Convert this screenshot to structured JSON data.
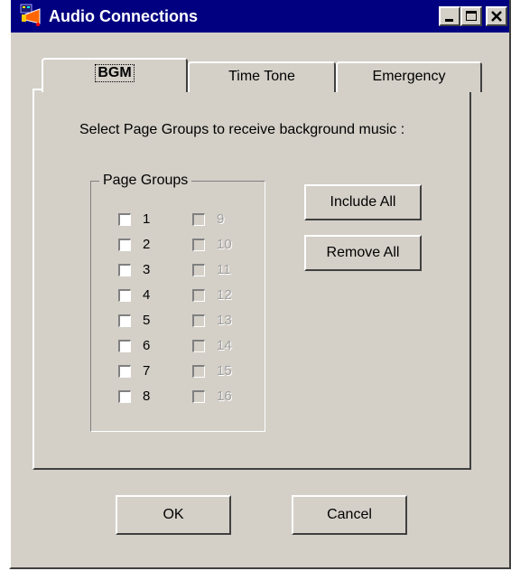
{
  "window": {
    "title": "Audio Connections",
    "titlebar_color": "#000080",
    "controls": [
      "minimize-icon",
      "maximize-icon",
      "close-icon"
    ]
  },
  "tabs": [
    {
      "label": "BGM",
      "active": true
    },
    {
      "label": "Time Tone",
      "active": false
    },
    {
      "label": "Emergency",
      "active": false
    }
  ],
  "instruction": "Select Page Groups to receive background music :",
  "page_groups": {
    "title": "Page Groups",
    "enabled": [
      {
        "label": "1",
        "checked": false
      },
      {
        "label": "2",
        "checked": false
      },
      {
        "label": "3",
        "checked": false
      },
      {
        "label": "4",
        "checked": false
      },
      {
        "label": "5",
        "checked": false
      },
      {
        "label": "6",
        "checked": false
      },
      {
        "label": "7",
        "checked": false
      },
      {
        "label": "8",
        "checked": false
      }
    ],
    "disabled": [
      {
        "label": "9",
        "checked": false
      },
      {
        "label": "10",
        "checked": false
      },
      {
        "label": "11",
        "checked": false
      },
      {
        "label": "12",
        "checked": false
      },
      {
        "label": "13",
        "checked": false
      },
      {
        "label": "14",
        "checked": false
      },
      {
        "label": "15",
        "checked": false
      },
      {
        "label": "16",
        "checked": false
      }
    ]
  },
  "buttons": {
    "include_all": "Include All",
    "remove_all": "Remove All",
    "ok": "OK",
    "cancel": "Cancel"
  }
}
